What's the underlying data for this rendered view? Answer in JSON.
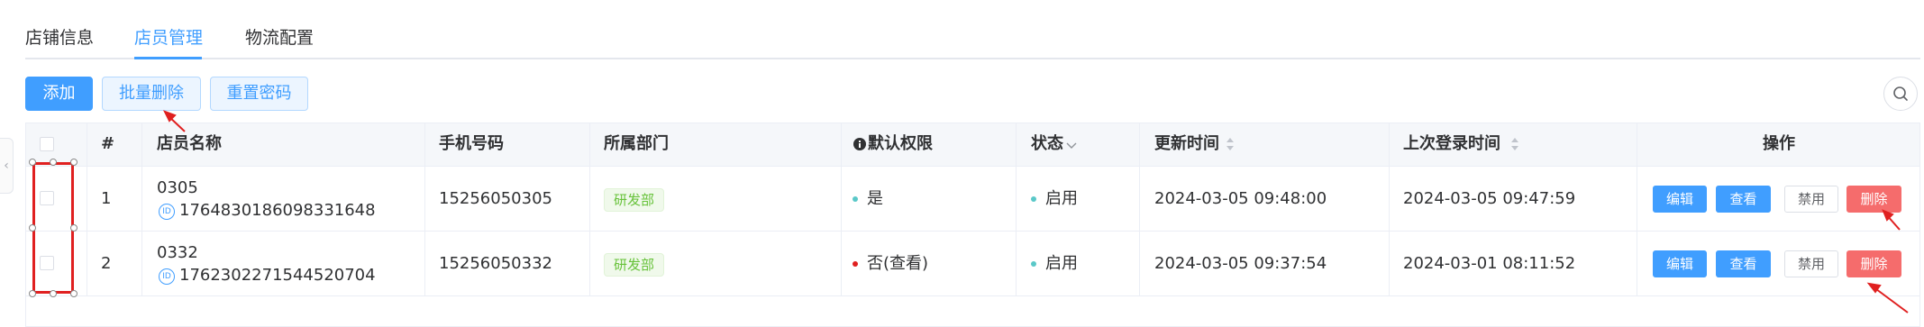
{
  "tabs": [
    {
      "label": "店铺信息",
      "active": false
    },
    {
      "label": "店员管理",
      "active": true
    },
    {
      "label": "物流配置",
      "active": false
    }
  ],
  "toolbar": {
    "add_label": "添加",
    "batch_delete_label": "批量删除",
    "reset_password_label": "重置密码"
  },
  "table": {
    "columns": {
      "index": "#",
      "name": "店员名称",
      "phone": "手机号码",
      "dept": "所属部门",
      "perm": "默认权限",
      "status": "状态",
      "updated": "更新时间",
      "last_login": "上次登录时间",
      "ops": "操作"
    },
    "rows": [
      {
        "index": "1",
        "name": "0305",
        "id_badge": "ID",
        "id": "1764830186098331648",
        "phone": "15256050305",
        "dept": "研发部",
        "perm": "是",
        "perm_color": "#5ac8c8",
        "status": "启用",
        "status_color": "#5ac8c8",
        "updated": "2024-03-05 09:48:00",
        "last_login": "2024-03-05 09:47:59"
      },
      {
        "index": "2",
        "name": "0332",
        "id_badge": "ID",
        "id": "1762302271544520704",
        "phone": "15256050332",
        "dept": "研发部",
        "perm": "否(查看)",
        "perm_color": "#e02020",
        "status": "启用",
        "status_color": "#5ac8c8",
        "updated": "2024-03-05 09:37:54",
        "last_login": "2024-03-01 08:11:52"
      }
    ],
    "actions": {
      "edit": "编辑",
      "view": "查看",
      "disable": "禁用",
      "delete": "删除"
    }
  },
  "icons": {
    "search": "search-icon",
    "info": "info-icon",
    "sort": "sort-icon",
    "filter": "chevron-down-icon",
    "collapse": "chevron-left-icon"
  },
  "colors": {
    "primary": "#409eff",
    "danger": "#f56c6c",
    "success": "#67c23a",
    "annotation": "#e02020"
  }
}
